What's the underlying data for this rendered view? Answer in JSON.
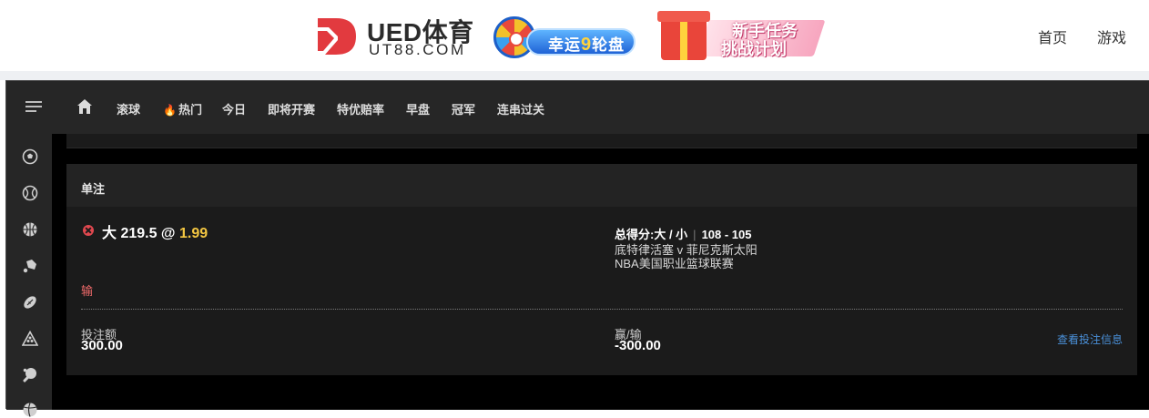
{
  "header": {
    "logo_title": "UED体育",
    "logo_subtitle": "UT88.COM",
    "promo_wheel_label": "幸运",
    "promo_wheel_number": "9",
    "promo_wheel_suffix": "轮盘",
    "promo_gift_line1": "新手任务",
    "promo_gift_line2": "挑战计划",
    "nav": {
      "home": "首页",
      "games": "游戏"
    }
  },
  "menu": {
    "items": [
      "滚球",
      "热门",
      "今日",
      "即将开赛",
      "特优赔率",
      "早盘",
      "冠军",
      "连串过关"
    ]
  },
  "sidebar": {
    "icons": [
      "soccer-icon",
      "tennis-icon",
      "basketball-icon",
      "badminton-icon",
      "football-icon",
      "snooker-icon",
      "table-tennis-icon",
      "volleyball-icon"
    ]
  },
  "bet": {
    "title": "单注",
    "selection": "大 219.5 @",
    "odds": "1.99",
    "market": "总得分:大 / 小",
    "score": "108 - 105",
    "match": "底特律活塞 v 菲尼克斯太阳",
    "league": "NBA美国职业篮球联赛",
    "result": "输",
    "stake_label": "投注额",
    "stake_value": "300.00",
    "pnl_label": "赢/输",
    "pnl_value": "-300.00",
    "details_link": "查看投注信息"
  },
  "colors": {
    "odds": "#f4c742",
    "loss": "#ef6a6a",
    "link": "#4a90d9",
    "logo_red": "#e23a3f"
  }
}
